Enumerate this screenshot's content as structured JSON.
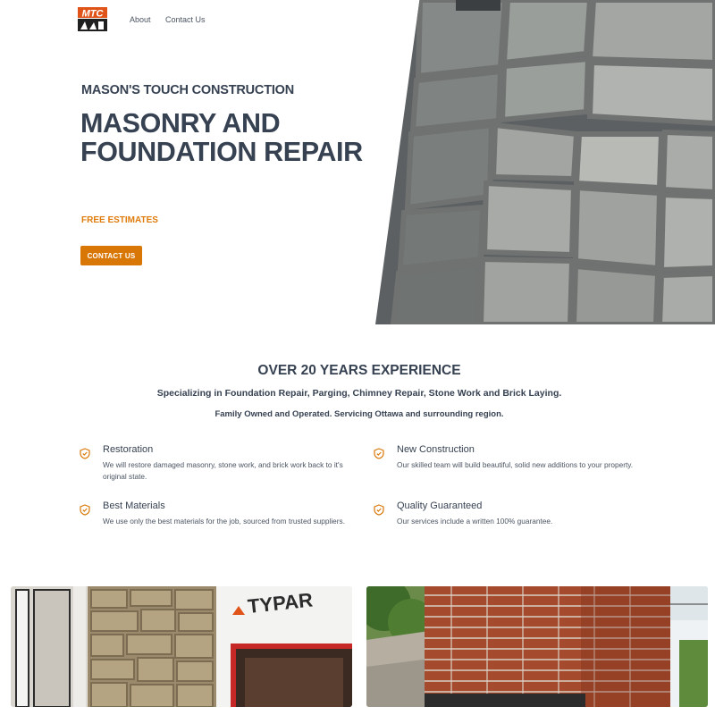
{
  "nav": {
    "logo_text": "MTC",
    "links": [
      {
        "label": "About"
      },
      {
        "label": "Contact Us"
      }
    ]
  },
  "hero": {
    "company": "MASON'S TOUCH CONSTRUCTION",
    "headline": "MASONRY AND FOUNDATION REPAIR",
    "tagline": "FREE ESTIMATES",
    "cta_label": "CONTACT US",
    "image": "stone-wall-photo"
  },
  "experience": {
    "heading": "OVER 20 YEARS EXPERIENCE",
    "subheading": "Specializing in Foundation Repair, Parging, Chimney Repair, Stone Work and Brick Laying.",
    "note": "Family Owned and Operated. Servicing Ottawa and surrounding region."
  },
  "features": [
    {
      "icon": "shield-check-icon",
      "title": "Restoration",
      "description": "We will restore damaged masonry, stone work, and brick work back to it's original state."
    },
    {
      "icon": "shield-check-icon",
      "title": "New Construction",
      "description": "Our skilled team will build beautiful, solid new additions to your property."
    },
    {
      "icon": "shield-check-icon",
      "title": "Best Materials",
      "description": "We use only the best materials for the job, sourced from trusted suppliers."
    },
    {
      "icon": "shield-check-icon",
      "title": "Quality Guaranteed",
      "description": "Our services include a written 100% guarantee."
    }
  ],
  "gallery": {
    "items": [
      {
        "image": "stone-column-construction-photo",
        "sign_text": "TYPAR"
      },
      {
        "image": "brick-chimney-photo"
      }
    ]
  },
  "colors": {
    "accent": "#d97706",
    "heading": "#364152",
    "text": "#4b5563",
    "background": "#ffffff"
  }
}
